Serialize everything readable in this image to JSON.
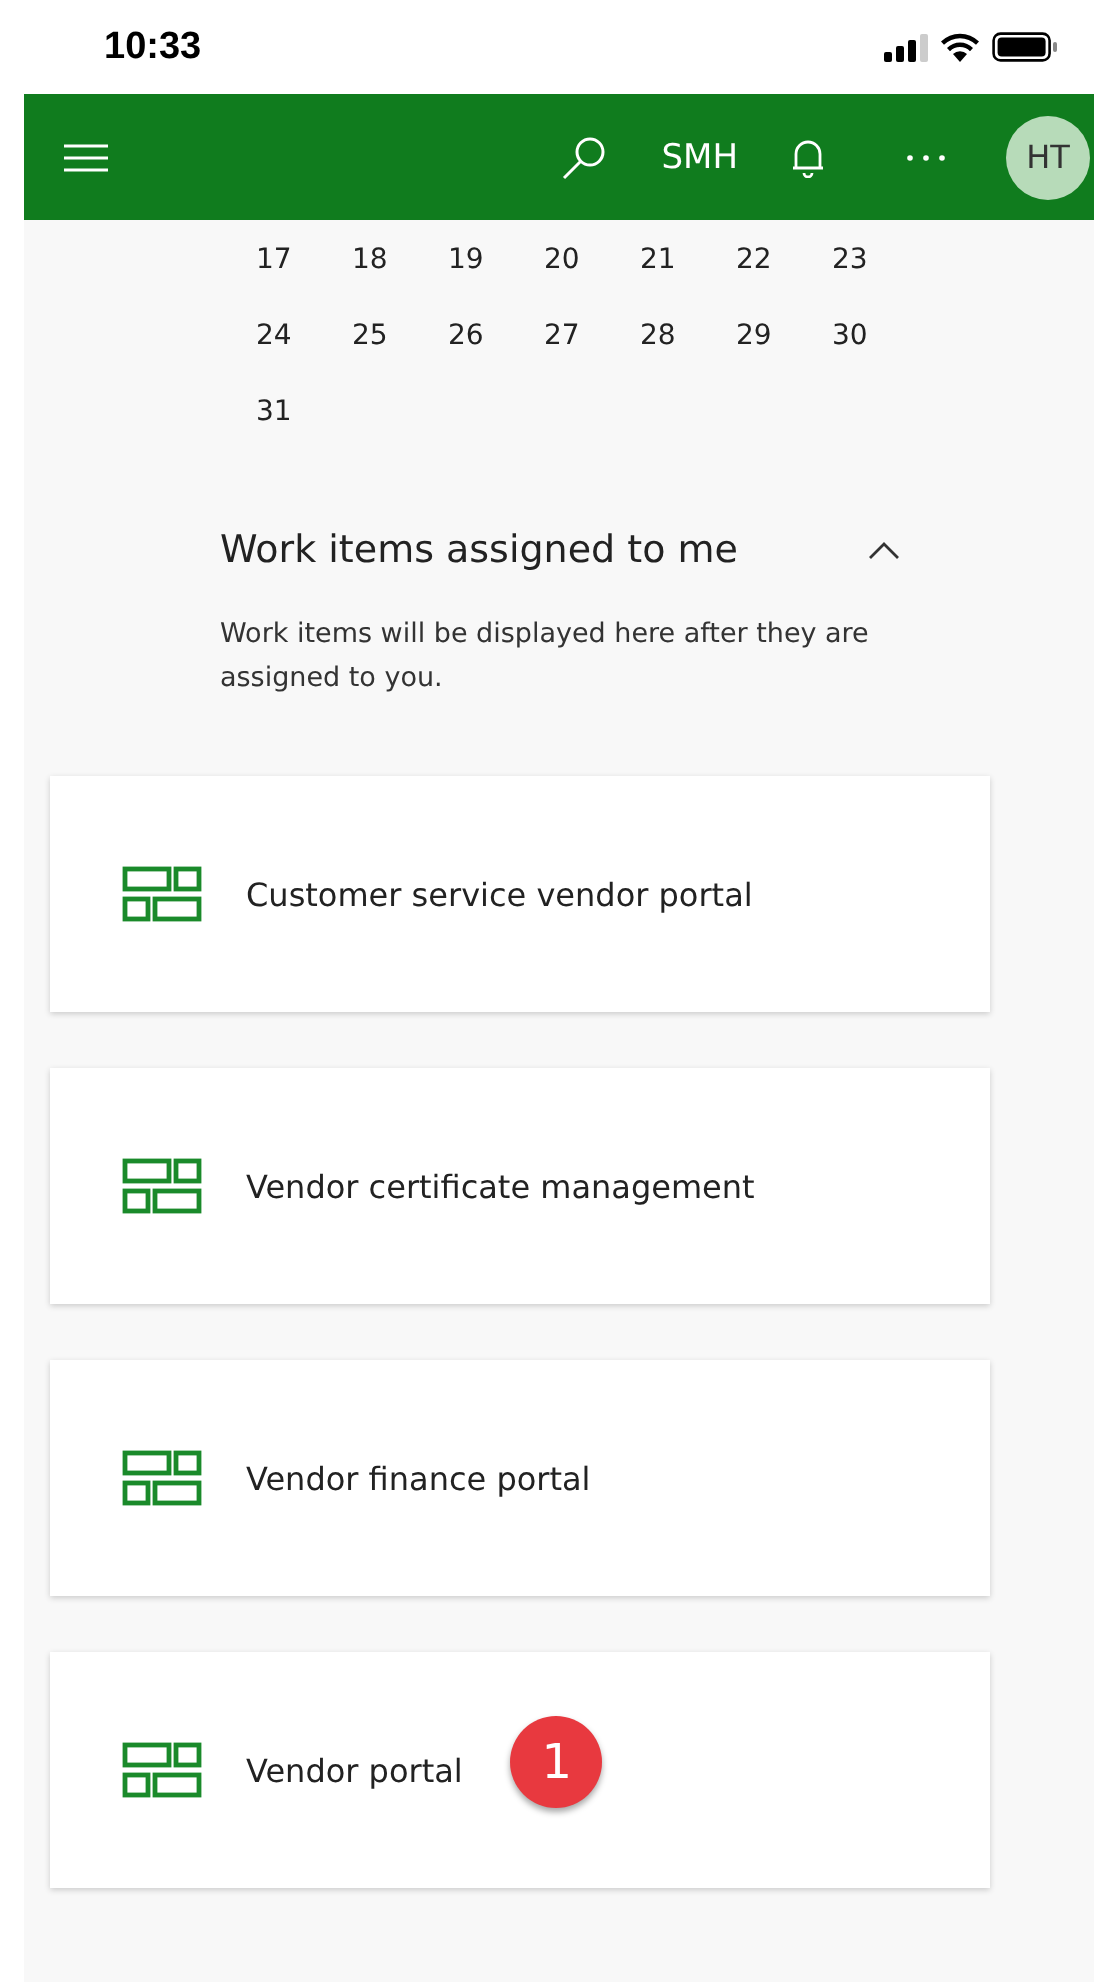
{
  "status_bar": {
    "time": "10:33"
  },
  "header": {
    "company": "SMH",
    "avatar": "HT"
  },
  "calendar": {
    "weeks": [
      [
        "17",
        "18",
        "19",
        "20",
        "21",
        "22",
        "23"
      ],
      [
        "24",
        "25",
        "26",
        "27",
        "28",
        "29",
        "30"
      ],
      [
        "31"
      ]
    ]
  },
  "work_items": {
    "title": "Work items assigned to me",
    "expanded": true,
    "message": "Work items will be displayed here after they are assigned to you."
  },
  "tiles": [
    {
      "label": "Customer service vendor portal"
    },
    {
      "label": "Vendor certificate management"
    },
    {
      "label": "Vendor finance portal"
    },
    {
      "label": "Vendor portal",
      "badge": "1"
    }
  ]
}
